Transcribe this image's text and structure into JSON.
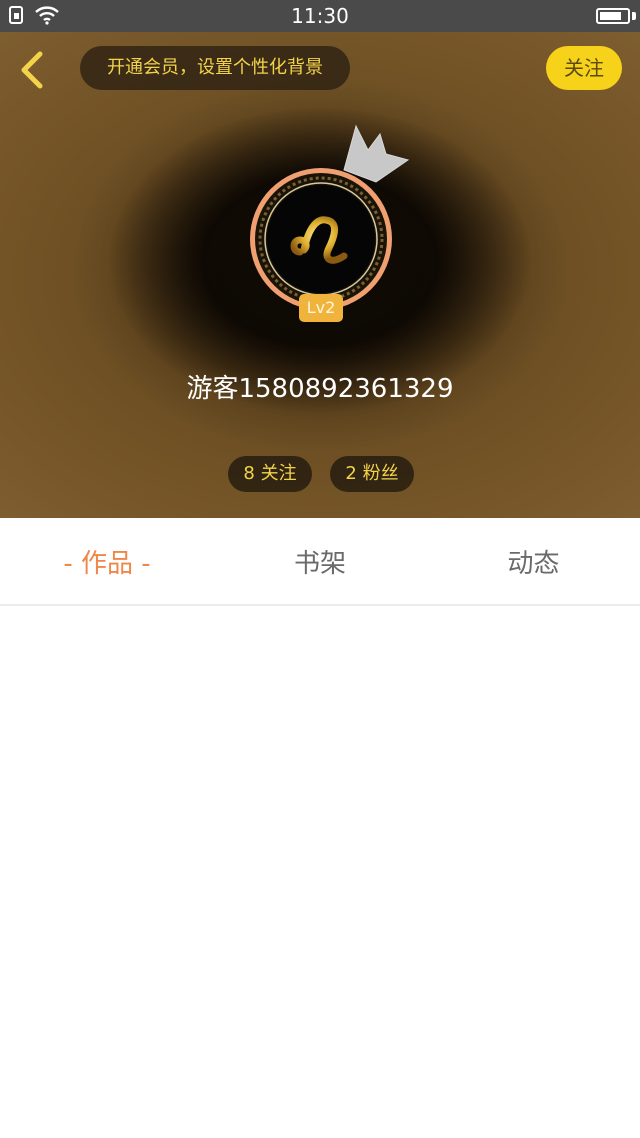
{
  "status_bar": {
    "time": "11:30",
    "icons": [
      "sim-icon",
      "wifi-icon",
      "battery-icon"
    ],
    "battery_level": 0.8
  },
  "header": {
    "vip_banner": "开通会员，设置个性化背景",
    "follow_label": "关注",
    "level": "Lv2",
    "username": "游客1580892361329",
    "following": "8 关注",
    "fans": "2 粉丝",
    "icons": [
      "back-icon",
      "crown-icon",
      "leo-zodiac-avatar"
    ]
  },
  "tabs": {
    "works": "- 作品 -",
    "shelf": "书架",
    "dynamic": "动态",
    "active": "works"
  },
  "colors": {
    "accent_yellow": "#f6d21b",
    "banner_text": "#f3d34a",
    "active_tab": "#f0874a",
    "level_badge": "#f0b43c"
  }
}
